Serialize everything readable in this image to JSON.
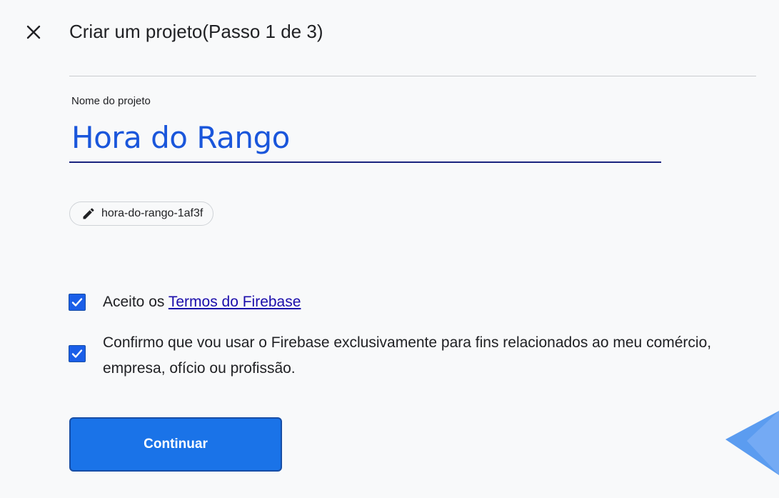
{
  "header": {
    "title": "Criar um projeto(Passo 1 de 3)",
    "close_icon": "close-icon"
  },
  "form": {
    "name_label": "Nome do projeto",
    "name_value": "Hora do Rango",
    "project_id": "hora-do-rango-1af3f",
    "project_id_icon": "pencil-icon"
  },
  "terms": {
    "accept_prefix": "Aceito os ",
    "accept_link": "Termos do Firebase",
    "accept_checked": true,
    "confirm_text": "Confirmo que vou usar o Firebase exclusivamente para fins relacionados ao meu comércio, empresa, ofício ou profissão.",
    "confirm_checked": true
  },
  "actions": {
    "continue_label": "Continuar"
  },
  "colors": {
    "accent": "#1a73e8",
    "input_text": "#1a56db",
    "link": "#1a0dab",
    "background": "#f8f9fa"
  }
}
